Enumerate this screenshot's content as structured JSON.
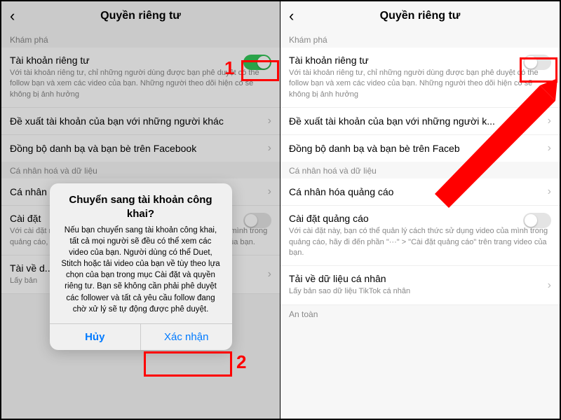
{
  "header": {
    "title": "Quyền riêng tư"
  },
  "sections": {
    "discovery": "Khám phá",
    "personal": "Cá nhân hoá và dữ liệu",
    "safety": "An toàn"
  },
  "rows": {
    "private_account": {
      "title": "Tài khoản riêng tư",
      "desc": "Với tài khoản riêng tư, chỉ những người dùng được bạn phê duyệt có thể follow bạn và xem các video của bạn. Những người theo dõi hiện có sẽ không bị ảnh hưởng"
    },
    "suggest": {
      "title": "Đề xuất tài khoản của bạn với những người khác"
    },
    "suggest_r": {
      "title": "Đề xuất tài khoản của bạn với những người k..."
    },
    "sync": {
      "title": "Đồng bộ danh bạ và bạn bè trên Facebook"
    },
    "sync_r": {
      "title": "Đồng bộ danh bạ và bạn bè trên Faceb"
    },
    "personalize_short": {
      "title": "Cá nhân hóa quảng cáo",
      "title_short": "Cá nhân"
    },
    "ads_settings": {
      "title": "Cài đặt quảng cáo",
      "title_short": "Cài đặt",
      "desc": "Với cài đặt này, bạn có thể quản lý cách thức sử dụng video của mình trong quảng cáo, hãy đi đến phần \"···\" > \"Cài đặt quảng cáo\" trên trang video của bạn.",
      "desc_short": "Với cài đặt này, bạn có thể quản lý cách thức sử dụng ... eo của mình trong quảng cáo, hãy đi đến phần \"···\" > \"C... o cáo\" trên trang video của bạn."
    },
    "download": {
      "title": "Tải về dữ liệu cá nhân",
      "title_short": "Tài về d...",
      "sub": "Lấy bản sao dữ liệu TikTok cá nhân",
      "sub_short": "Lấy bản"
    }
  },
  "dialog": {
    "title": "Chuyển sang tài khoản công khai?",
    "msg": "Nếu bạn chuyển sang tài khoản công khai, tất cả mọi người sẽ đều có thể xem các video của bạn. Người dùng có thể Duet, Stitch hoặc tải video của bạn về tùy theo lựa chọn của bạn trong mục Cài đặt và quyền riêng tư. Bạn sẽ không cần phải phê duyệt các follower và tất cả yêu cầu follow đang chờ xử lý sẽ tự động được phê duyệt.",
    "cancel": "Hủy",
    "confirm": "Xác nhận"
  },
  "annot": {
    "one": "1",
    "two": "2"
  }
}
